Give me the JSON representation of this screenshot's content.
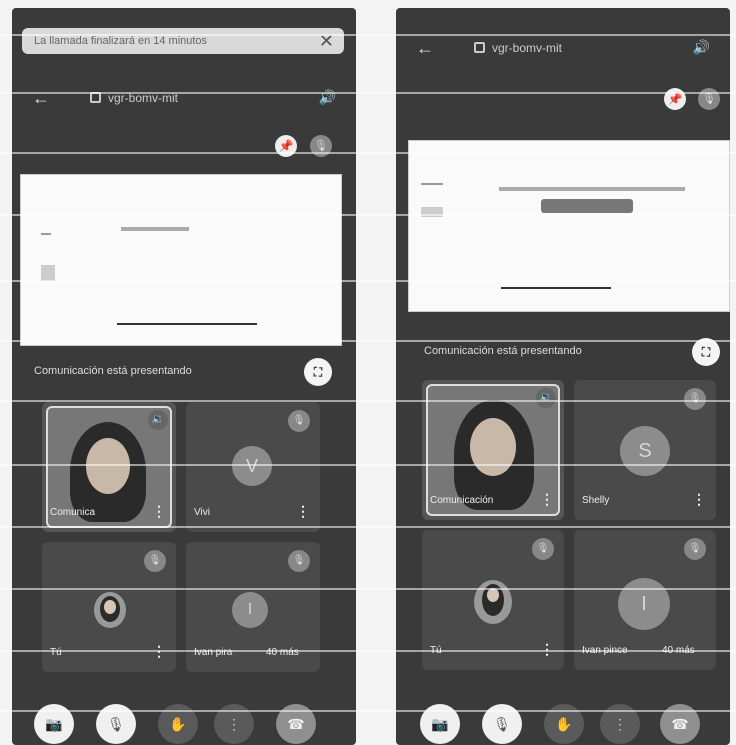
{
  "left": {
    "banner": {
      "text": "La llamada finalizará en 14 minutos",
      "close": "✕"
    },
    "meeting_code": "vgr-bomv-mit",
    "presenting": "Comunicación está presentando",
    "tiles": [
      {
        "name": "Comunica",
        "avatar": ""
      },
      {
        "name": "Vivi",
        "avatar": "V"
      },
      {
        "name": "Tú",
        "avatar": ""
      },
      {
        "name": "Ivan pira",
        "extra": "40 más",
        "avatar": "I"
      }
    ]
  },
  "right": {
    "meeting_code": "vgr-bomv-mit",
    "presenting": "Comunicación está presentando",
    "tiles": [
      {
        "name": "Comunicación",
        "avatar": ""
      },
      {
        "name": "Shelly",
        "avatar": "S"
      },
      {
        "name": "Tú",
        "avatar": ""
      },
      {
        "name": "Ivan pince",
        "extra": "40 más",
        "avatar": "I"
      }
    ]
  },
  "icons": {
    "back": "←",
    "speaker": "🔊",
    "pin": "📌",
    "mic_off": "🎙",
    "fullscreen": "⛶",
    "camera_off": "📷",
    "hand": "✋",
    "more": "⋮",
    "end_call": "☎",
    "speaking": "🔉"
  }
}
